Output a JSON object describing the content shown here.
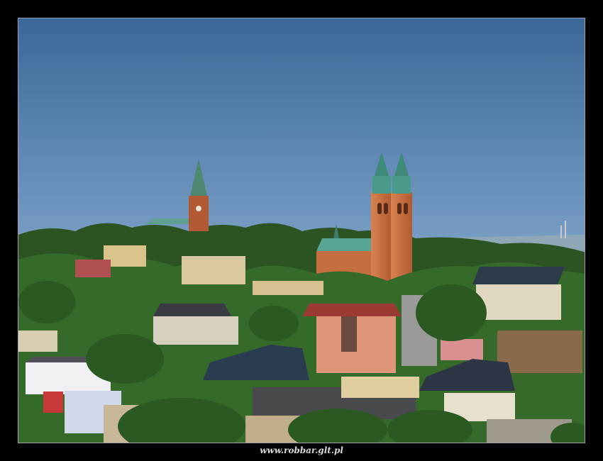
{
  "caption": "www.robbar.glt.pl",
  "colors": {
    "frame": "#000000",
    "sky_top": "#3f6a9a",
    "sky_bottom": "#a9c2d8",
    "foliage": "#2f5a24",
    "brick": "#c86a3a",
    "copper_roof": "#4a9a8a"
  },
  "scene": {
    "subject": "town skyline with twin-towered brick basilica",
    "elements": [
      "sky",
      "distant-church-spire",
      "basilica-twin-towers",
      "trees",
      "houses",
      "industrial-chimneys"
    ]
  }
}
